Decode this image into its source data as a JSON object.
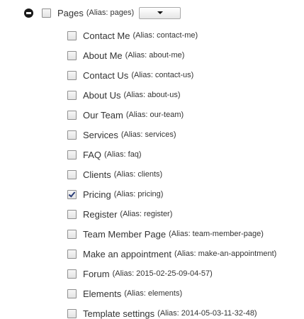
{
  "root": {
    "label": "Pages",
    "alias": "(Alias: pages)",
    "checked": false,
    "expanded": true,
    "icon": "collapse-minus-icon",
    "dropdown_icon": "caret-down-icon"
  },
  "items": [
    {
      "label": "Contact Me",
      "alias": "(Alias: contact-me)",
      "checked": false
    },
    {
      "label": "About Me",
      "alias": "(Alias: about-me)",
      "checked": false
    },
    {
      "label": "Contact Us",
      "alias": "(Alias: contact-us)",
      "checked": false
    },
    {
      "label": "About Us",
      "alias": "(Alias: about-us)",
      "checked": false
    },
    {
      "label": "Our Team",
      "alias": "(Alias: our-team)",
      "checked": false
    },
    {
      "label": "Services",
      "alias": "(Alias: services)",
      "checked": false
    },
    {
      "label": "FAQ",
      "alias": "(Alias: faq)",
      "checked": false
    },
    {
      "label": "Clients",
      "alias": "(Alias: clients)",
      "checked": false
    },
    {
      "label": "Pricing",
      "alias": "(Alias: pricing)",
      "checked": true
    },
    {
      "label": "Register",
      "alias": "(Alias: register)",
      "checked": false
    },
    {
      "label": "Team Member Page",
      "alias": "(Alias: team-member-page)",
      "checked": false
    },
    {
      "label": "Make an appointment",
      "alias": "(Alias: make-an-appointment)",
      "checked": false
    },
    {
      "label": "Forum",
      "alias": "(Alias: 2015-02-25-09-04-57)",
      "checked": false
    },
    {
      "label": "Elements",
      "alias": "(Alias: elements)",
      "checked": false
    },
    {
      "label": "Template settings",
      "alias": "(Alias: 2014-05-03-11-32-48)",
      "checked": false
    }
  ]
}
